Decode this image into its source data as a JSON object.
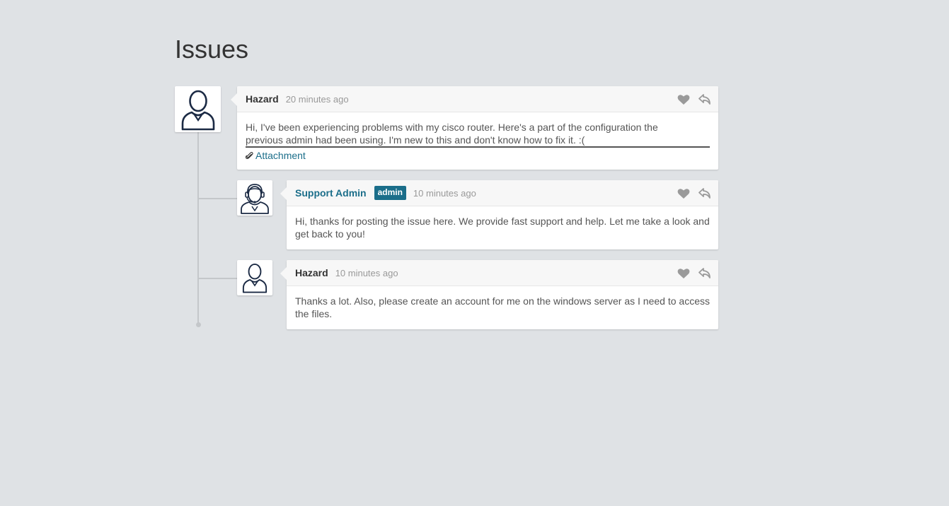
{
  "page": {
    "title": "Issues"
  },
  "comments": [
    {
      "author": "Hazard",
      "time": "20 minutes ago",
      "text_line1": "Hi, I've been experiencing problems with my cisco router. Here's a part of the configuration the",
      "text_line2": "previous admin had been using. I'm new to this and don't know how to fix it. :(",
      "attachment_label": "Attachment",
      "avatar_icon": "user-icon"
    },
    {
      "author": "Support Admin",
      "badge": "admin",
      "time": "10 minutes ago",
      "text": "Hi, thanks for posting the issue here. We provide fast support and help. Let me take a look and get back to you!",
      "avatar_icon": "support-agent-icon"
    },
    {
      "author": "Hazard",
      "time": "10 minutes ago",
      "text": "Thanks a lot. Also, please create an account for me on the windows server as I need to access the files.",
      "avatar_icon": "user-icon"
    }
  ],
  "icons": {
    "like": "heart-icon",
    "reply": "reply-icon",
    "attachment": "paperclip-icon"
  },
  "colors": {
    "background": "#dfe2e5",
    "accent": "#1b6e8a",
    "thread_line": "#c4c7ca"
  }
}
